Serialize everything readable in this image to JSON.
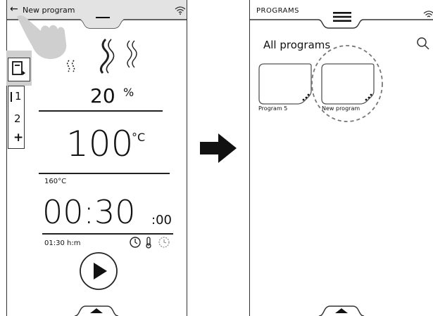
{
  "left_screen": {
    "header": {
      "back_icon": "arrow-left-icon",
      "title": "New program",
      "wifi_icon": "wifi-icon",
      "handle_icon": "minus-icon"
    },
    "sidebar": {
      "items": [
        "1",
        "2",
        "+"
      ],
      "top_icon": "program-card-icon"
    },
    "steam": {
      "percent_value": "20",
      "percent_unit": "%"
    },
    "temperature": {
      "value": "100",
      "unit": "°C",
      "sub_label": "160°C"
    },
    "time": {
      "value": "00:30",
      "seconds": ":00",
      "sub_label": "01:30 h:m"
    },
    "play_icon": "play-icon",
    "bottom_handle_icon": "caret-up-icon",
    "gesture_icon": "tap-hand-icon"
  },
  "arrow_icon": "right-arrow-icon",
  "right_screen": {
    "header": {
      "title": "PROGRAMS",
      "menu_icon": "hamburger-menu-icon",
      "wifi_icon": "wifi-icon"
    },
    "heading": "All programs",
    "search_icon": "search-icon",
    "programs": [
      {
        "label": "Program 5"
      },
      {
        "label": "New program"
      }
    ],
    "bottom_handle_icon": "caret-up-icon"
  },
  "colors": {
    "header_gray": "#e2e2e2",
    "highlight_gray": "#c8c8c8",
    "stroke": "#222222"
  }
}
